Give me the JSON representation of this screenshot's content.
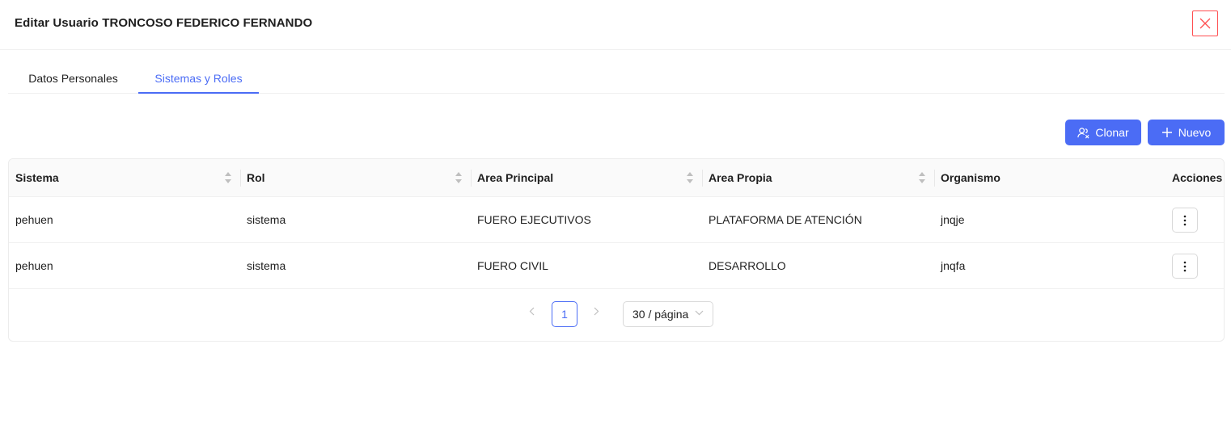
{
  "modal": {
    "title": "Editar Usuario TRONCOSO FEDERICO FERNANDO"
  },
  "tabs": [
    {
      "label": "Datos Personales",
      "active": false
    },
    {
      "label": "Sistemas y Roles",
      "active": true
    }
  ],
  "toolbar": {
    "clone_label": "Clonar",
    "new_label": "Nuevo"
  },
  "table": {
    "columns": [
      "Sistema",
      "Rol",
      "Area Principal",
      "Area Propia",
      "Organismo",
      "Acciones"
    ],
    "rows": [
      {
        "sistema": "pehuen",
        "rol": "sistema",
        "area_principal": "FUERO EJECUTIVOS",
        "area_propia": "PLATAFORMA DE ATENCIÓN",
        "organismo": "jnqje"
      },
      {
        "sistema": "pehuen",
        "rol": "sistema",
        "area_principal": "FUERO CIVIL",
        "area_propia": "DESARROLLO",
        "organismo": "jnqfa"
      }
    ]
  },
  "pagination": {
    "current_page": "1",
    "page_size": "30 / página"
  },
  "colors": {
    "primary": "#4b6cf5",
    "danger": "#ff4d4f"
  },
  "icons": {
    "close": "close-icon",
    "clone": "clone-user-icon",
    "new": "plus-icon",
    "actions": "more-vertical-icon",
    "sort": "sort-icon",
    "prev": "chevron-left-icon",
    "next": "chevron-right-icon",
    "select": "chevron-down-icon"
  }
}
